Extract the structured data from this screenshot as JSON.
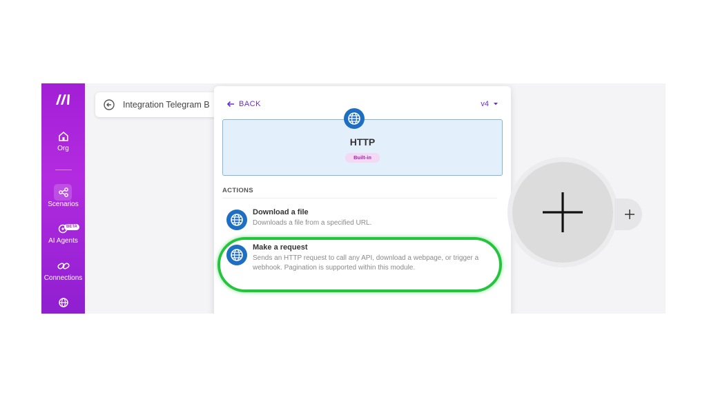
{
  "sidebar": {
    "items": [
      {
        "label": "Org",
        "icon": "home-icon"
      },
      {
        "label": "Scenarios",
        "icon": "share-nodes-icon"
      },
      {
        "label": "AI Agents",
        "icon": "ai-agent-icon",
        "badge": "BETA"
      },
      {
        "label": "Connections",
        "icon": "link-icon"
      },
      {
        "label": "",
        "icon": "globe-icon"
      }
    ]
  },
  "scenario": {
    "title": "Integration Telegram B"
  },
  "panel": {
    "back_label": "BACK",
    "version": "v4",
    "module": {
      "name": "HTTP",
      "badge": "Built-in"
    },
    "actions_heading": "ACTIONS",
    "actions": [
      {
        "title": "Download a file",
        "description": "Downloads a file from a specified URL."
      },
      {
        "title": "Make a request",
        "description": "Sends an HTTP request to call any API, download a webpage, or trigger a webhook. Pagination is supported within this module."
      }
    ]
  },
  "colors": {
    "brand": "#a21fd6",
    "accent": "#6b2bd6",
    "highlight": "#24c43d",
    "http_blue": "#1e6fc2"
  }
}
